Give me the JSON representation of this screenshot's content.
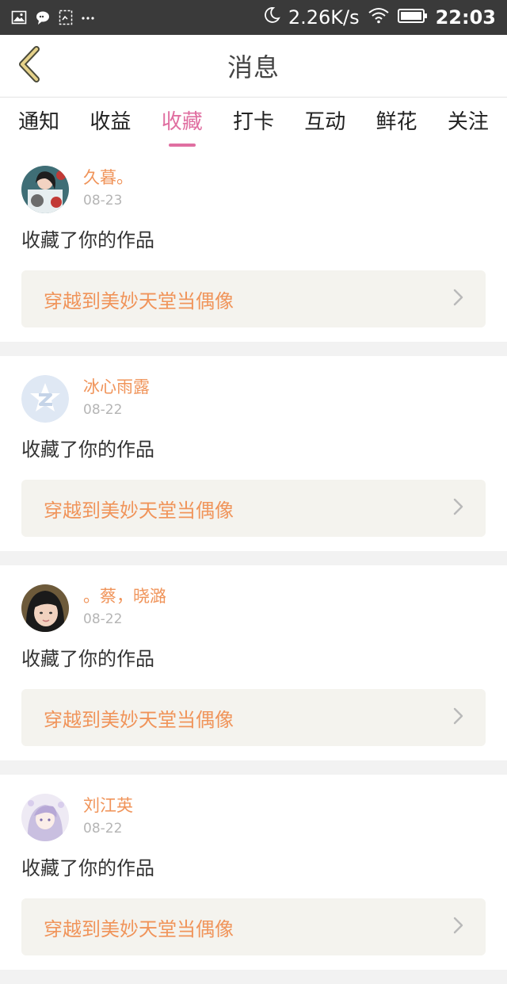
{
  "status_bar": {
    "network_speed": "2.26K/s",
    "time": "22:03",
    "left_icons": [
      "image-icon",
      "chat-bubble-icon",
      "screenshot-icon",
      "more-dots-icon"
    ],
    "right_icons": [
      "moon-icon",
      "wifi-icon",
      "battery-icon"
    ]
  },
  "header": {
    "title": "消息",
    "back_icon": "chevron-left-icon",
    "accent_color": "#e6d28a"
  },
  "tabs": [
    {
      "label": "通知",
      "active": false
    },
    {
      "label": "收益",
      "active": false
    },
    {
      "label": "收藏",
      "active": true
    },
    {
      "label": "打卡",
      "active": false
    },
    {
      "label": "互动",
      "active": false
    },
    {
      "label": "鲜花",
      "active": false
    },
    {
      "label": "关注",
      "active": false
    }
  ],
  "colors": {
    "active_tab": "#e06fa1",
    "name_text": "#f0945a",
    "date_text": "#b5b5b5",
    "link_bg": "#f4f3ee"
  },
  "messages": [
    {
      "user": "久暮。",
      "date": "08-23",
      "action": "收藏了你的作品",
      "work_title": "穿越到美妙天堂当偶像",
      "avatar": "photo-avatar-girl-cat"
    },
    {
      "user": "冰心雨露",
      "date": "08-22",
      "action": "收藏了你的作品",
      "work_title": "穿越到美妙天堂当偶像",
      "avatar": "qzone-default-avatar"
    },
    {
      "user": "。蔡，晓潞",
      "date": "08-22",
      "action": "收藏了你的作品",
      "work_title": "穿越到美妙天堂当偶像",
      "avatar": "photo-avatar-girl"
    },
    {
      "user": "刘江英",
      "date": "08-22",
      "action": "收藏了你的作品",
      "work_title": "穿越到美妙天堂当偶像",
      "avatar": "anime-avatar-girl"
    }
  ]
}
